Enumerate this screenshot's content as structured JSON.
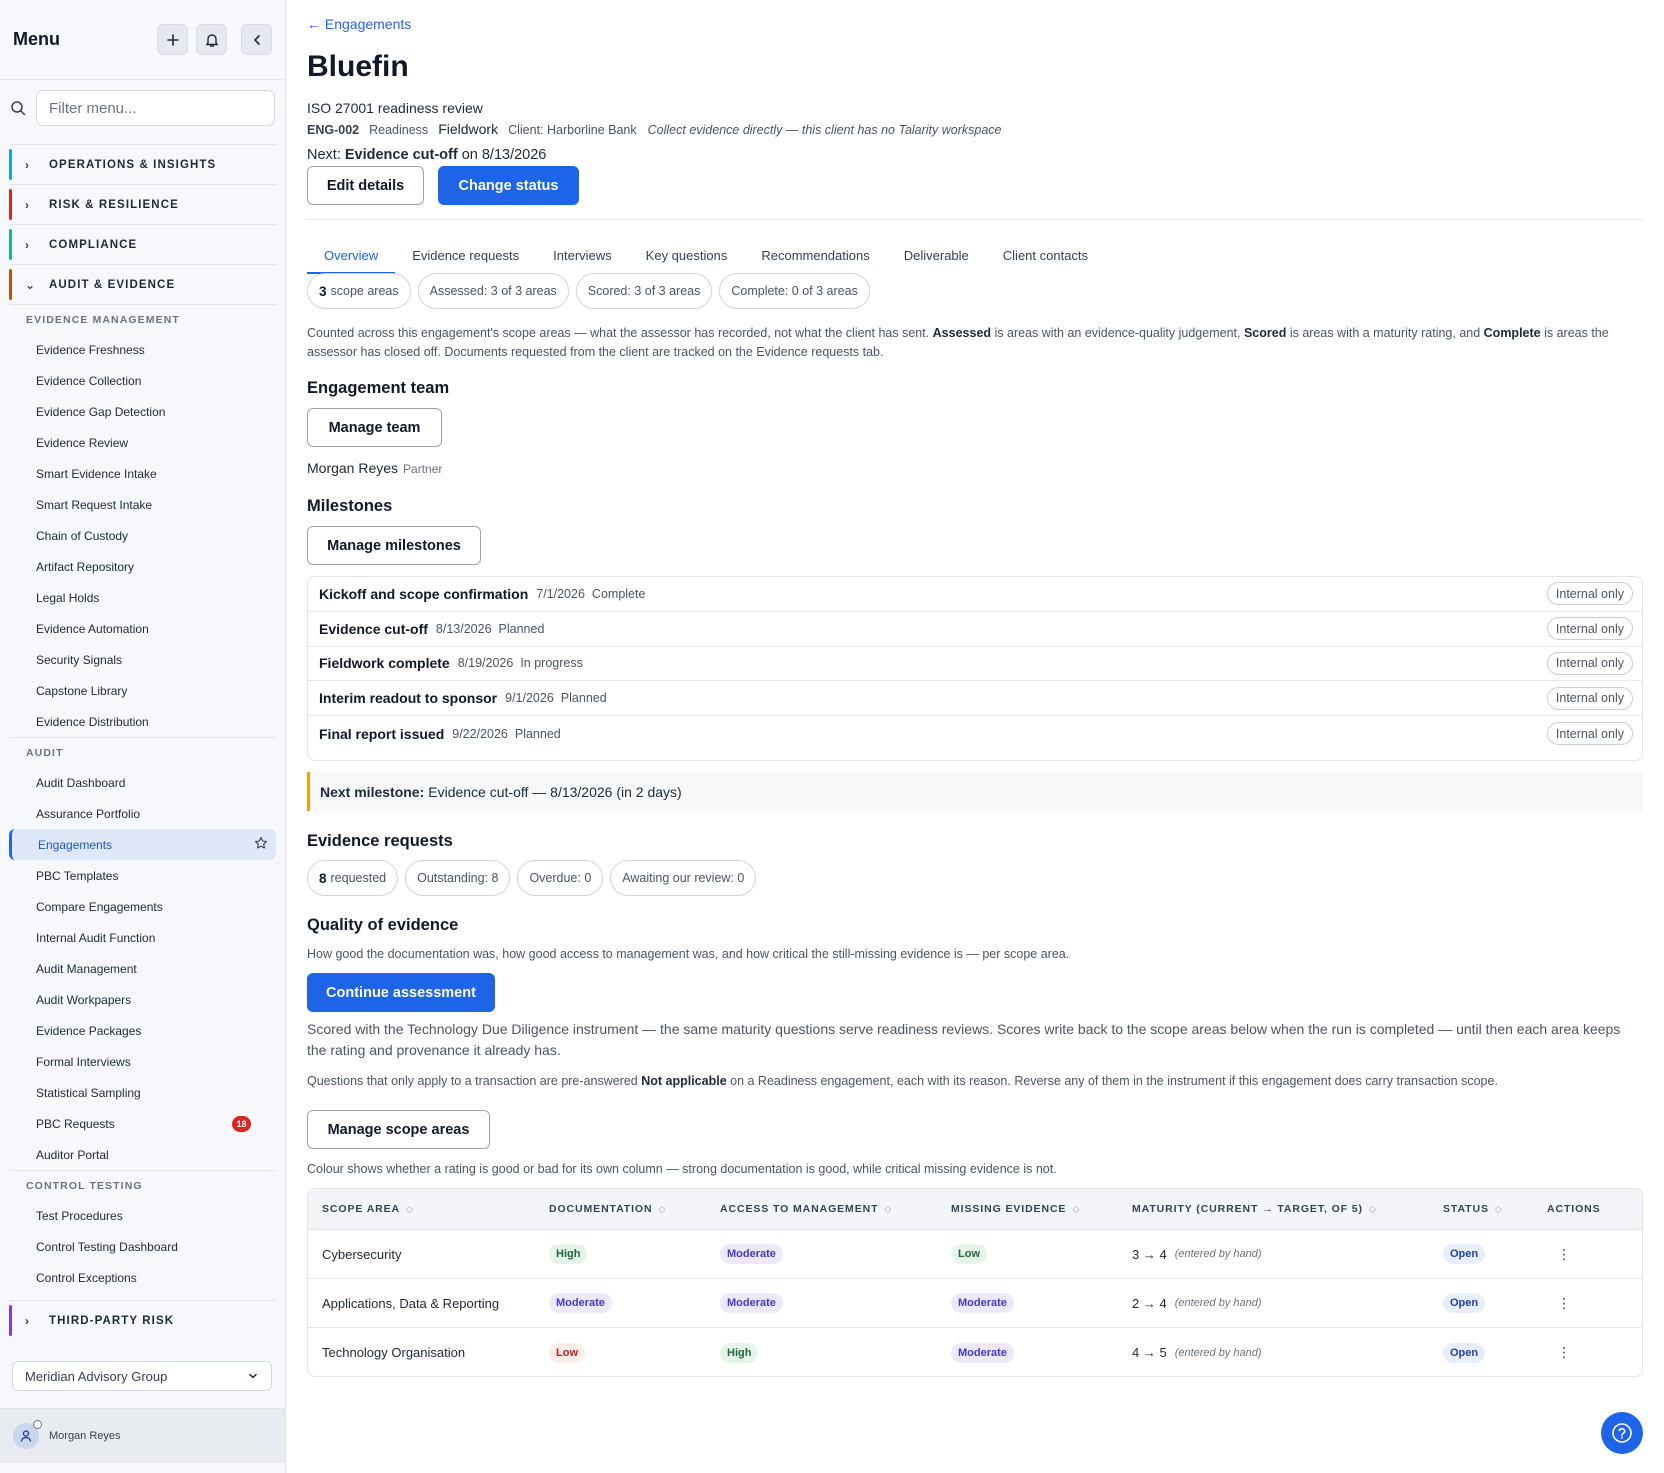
{
  "sidebar": {
    "title": "Menu",
    "filter_placeholder": "Filter menu...",
    "groups": [
      {
        "label": "OPERATIONS & INSIGHTS",
        "color": "#0ea5e9"
      },
      {
        "label": "RISK & RESILIENCE",
        "color": "#dc2626"
      },
      {
        "label": "COMPLIANCE",
        "color": "#10b981"
      },
      {
        "label": "AUDIT & EVIDENCE",
        "color": "#b45309"
      },
      {
        "label": "THIRD-PARTY RISK",
        "color": "#7c3aed"
      }
    ],
    "sections": {
      "evidence_management": "EVIDENCE MANAGEMENT",
      "audit": "AUDIT",
      "control_testing": "CONTROL TESTING"
    },
    "evidence_items": [
      "Evidence Freshness",
      "Evidence Collection",
      "Evidence Gap Detection",
      "Evidence Review",
      "Smart Evidence Intake",
      "Smart Request Intake",
      "Chain of Custody",
      "Artifact Repository",
      "Legal Holds",
      "Evidence Automation",
      "Security Signals",
      "Capstone Library",
      "Evidence Distribution"
    ],
    "audit_items": [
      "Audit Dashboard",
      "Assurance Portfolio",
      "Engagements",
      "PBC Templates",
      "Compare Engagements",
      "Internal Audit Function",
      "Audit Management",
      "Audit Workpapers",
      "Evidence Packages",
      "Formal Interviews",
      "Statistical Sampling",
      "PBC Requests",
      "Auditor Portal"
    ],
    "pbc_badge": "18",
    "control_items": [
      "Test Procedures",
      "Control Testing Dashboard",
      "Control Exceptions"
    ],
    "org": "Meridian Advisory Group",
    "user": "Morgan Reyes"
  },
  "header": {
    "back": "← Engagements",
    "title": "Bluefin",
    "subtitle": "ISO 27001 readiness review",
    "code": "ENG-002",
    "type": "Readiness",
    "phase": "Fieldwork",
    "client": "Client: Harborline Bank",
    "note": "Collect evidence directly — this client has no Talarity workspace",
    "next_prefix": "Next:",
    "next_label": "Evidence cut-off",
    "next_suffix": "on 8/13/2026",
    "edit_label": "Edit details",
    "status_label": "Change status"
  },
  "tabs": [
    "Overview",
    "Evidence requests",
    "Interviews",
    "Key questions",
    "Recommendations",
    "Deliverable",
    "Client contacts"
  ],
  "scope_chips": {
    "count": "3",
    "count_label": "scope areas",
    "assessed": "Assessed: 3 of 3 areas",
    "scored": "Scored: 3 of 3 areas",
    "complete": "Complete: 0 of 3 areas"
  },
  "scope_note": {
    "p1": "Counted across this engagement's scope areas — what the assessor has recorded, not what the client has sent. ",
    "b1": "Assessed",
    "p2": " is areas with an evidence-quality judgement, ",
    "b2": "Scored",
    "p3": " is areas with a maturity rating, and ",
    "b3": "Complete",
    "p4": " is areas the assessor has closed off. Documents requested from the client are tracked on the Evidence requests tab."
  },
  "team": {
    "heading": "Engagement team",
    "manage_label": "Manage team",
    "member_name": "Morgan Reyes",
    "member_role": "Partner"
  },
  "milestones": {
    "heading": "Milestones",
    "manage_label": "Manage milestones",
    "items": [
      {
        "name": "Kickoff and scope confirmation",
        "date": "7/1/2026",
        "status": "Complete",
        "visibility": "Internal only"
      },
      {
        "name": "Evidence cut-off",
        "date": "8/13/2026",
        "status": "Planned",
        "visibility": "Internal only"
      },
      {
        "name": "Fieldwork complete",
        "date": "8/19/2026",
        "status": "In progress",
        "visibility": "Internal only"
      },
      {
        "name": "Interim readout to sponsor",
        "date": "9/1/2026",
        "status": "Planned",
        "visibility": "Internal only"
      },
      {
        "name": "Final report issued",
        "date": "9/22/2026",
        "status": "Planned",
        "visibility": "Internal only"
      }
    ],
    "next_label": "Next milestone:",
    "next_value": "Evidence cut-off — 8/13/2026 (in 2 days)"
  },
  "evidence": {
    "heading": "Evidence requests",
    "count": "8",
    "count_label": "requested",
    "outstanding": "Outstanding: 8",
    "overdue": "Overdue: 0",
    "awaiting": "Awaiting our review: 0"
  },
  "quality": {
    "heading": "Quality of evidence",
    "desc": "How good the documentation was, how good access to management was, and how critical the still-missing evidence is — per scope area.",
    "continue_label": "Continue assessment",
    "scored_note": "Scored with the Technology Due Diligence instrument — the same maturity questions serve readiness reviews. Scores write back to the scope areas below when the run is completed — until then each area keeps the rating and provenance it already has.",
    "na_p1": "Questions that only apply to a transaction are pre-answered ",
    "na_b": "Not applicable",
    "na_p2": " on a Readiness engagement, each with its reason. Reverse any of them in the instrument if this engagement does carry transaction scope.",
    "manage_label": "Manage scope areas",
    "colour_note": "Colour shows whether a rating is good or bad for its own column — strong documentation is good, while critical missing evidence is not."
  },
  "table": {
    "headers": [
      "SCOPE AREA",
      "DOCUMENTATION",
      "ACCESS TO MANAGEMENT",
      "MISSING EVIDENCE",
      "MATURITY (CURRENT → TARGET, OF 5)",
      "STATUS",
      "ACTIONS"
    ],
    "rows": [
      {
        "area": "Cybersecurity",
        "documentation": "High",
        "access": "Moderate",
        "missing": "Low",
        "maturity": "3 → 4",
        "provenance": "(entered by hand)",
        "status": "Open"
      },
      {
        "area": "Applications, Data & Reporting",
        "documentation": "Moderate",
        "access": "Moderate",
        "missing": "Moderate",
        "maturity": "2 → 4",
        "provenance": "(entered by hand)",
        "status": "Open"
      },
      {
        "area": "Technology Organisation",
        "documentation": "Low",
        "access": "High",
        "missing": "Moderate",
        "maturity": "4 → 5",
        "provenance": "(entered by hand)",
        "status": "Open"
      }
    ]
  }
}
